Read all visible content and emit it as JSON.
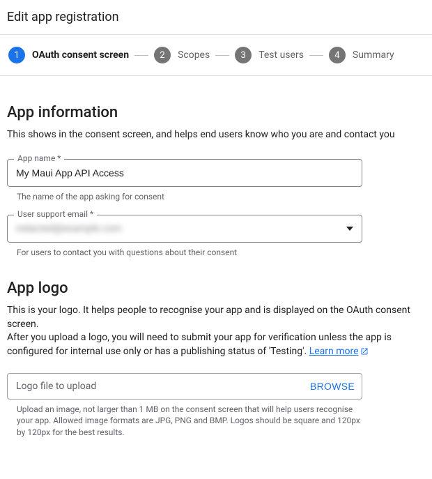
{
  "page_title": "Edit app registration",
  "stepper": {
    "steps": [
      {
        "num": "1",
        "label": "OAuth consent screen",
        "active": true
      },
      {
        "num": "2",
        "label": "Scopes",
        "active": false
      },
      {
        "num": "3",
        "label": "Test users",
        "active": false
      },
      {
        "num": "4",
        "label": "Summary",
        "active": false
      }
    ]
  },
  "app_info": {
    "heading": "App information",
    "description": "This shows in the consent screen, and helps end users know who you are and contact you",
    "app_name_label": "App name *",
    "app_name_value": "My Maui App API Access",
    "app_name_hint": "The name of the app asking for consent",
    "support_email_label": "User support email *",
    "support_email_value": "redacted@example.com",
    "support_email_hint": "For users to contact you with questions about their consent"
  },
  "app_logo": {
    "heading": "App logo",
    "desc_line1": "This is your logo. It helps people to recognise your app and is displayed on the OAuth consent screen.",
    "desc_line2_a": "After you upload a logo, you will need to submit your app for verification unless the app is configured for internal use only or has a publishing status of 'Testing'. ",
    "learn_more": "Learn more",
    "upload_label": "Logo file to upload",
    "browse_label": "BROWSE",
    "upload_hint": "Upload an image, not larger than 1 MB on the consent screen that will help users recognise your app. Allowed image formats are JPG, PNG and BMP. Logos should be square and 120px by 120px for the best results."
  }
}
